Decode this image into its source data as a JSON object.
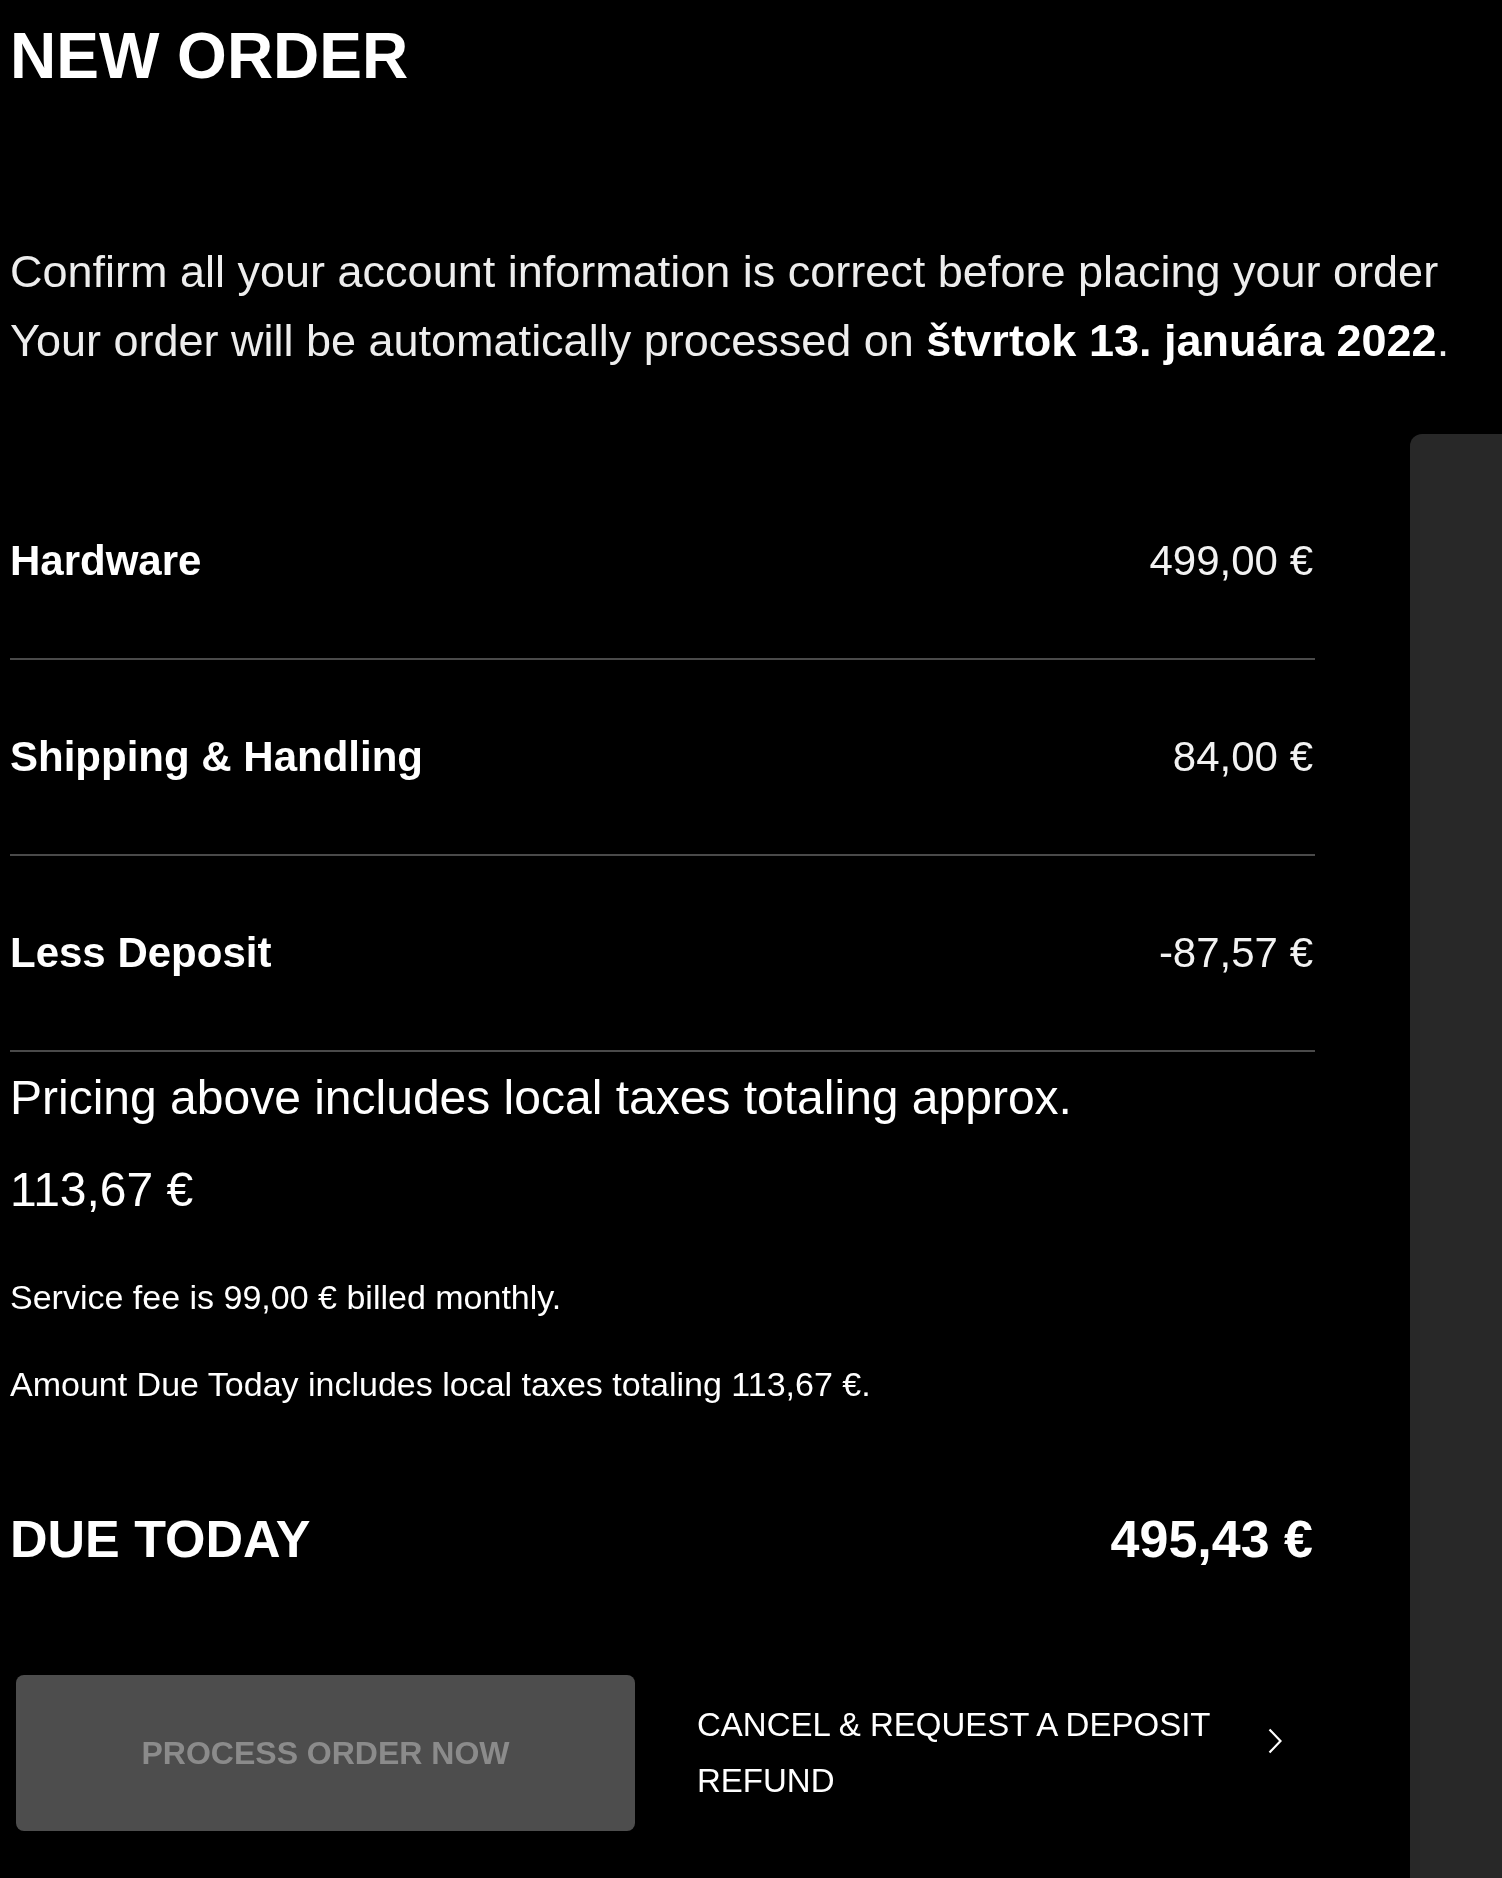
{
  "title": "NEW ORDER",
  "intro": [
    "Confirm all your account information is correct before placing your order",
    "Your order will be automatically processed on **štvrtok 13. januára 2022**."
  ],
  "line_items": [
    {
      "label": "Hardware",
      "amount": "499,00 €"
    },
    {
      "label": "Shipping & Handling",
      "amount": "84,00 €"
    },
    {
      "label": "Less Deposit",
      "amount": "-87,57 €"
    }
  ],
  "tax_note": {
    "text": "Pricing above includes local taxes totaling approx.",
    "amount": "113,67 €"
  },
  "notes": [
    "Service fee is 99,00 € billed monthly.",
    "Amount Due Today includes local taxes totaling 113,67 €."
  ],
  "total": {
    "label": "DUE TODAY",
    "amount": "495,43 €"
  },
  "process_button": {
    "label": "PROCESS ORDER NOW",
    "disabled": true
  },
  "cancel_link": {
    "label": "CANCEL & REQUEST A DEPOSIT REFUND"
  }
}
